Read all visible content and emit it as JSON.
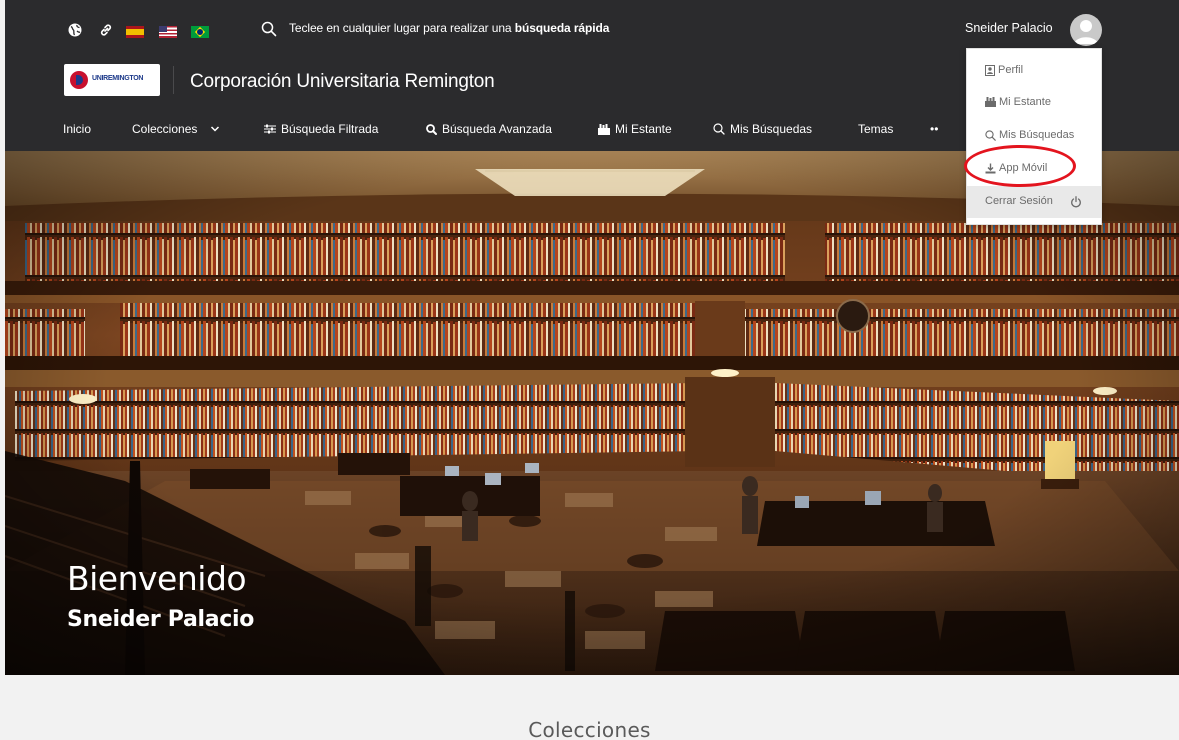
{
  "topbar": {
    "search_placeholder_prefix": "Teclee en cualquier lugar para realizar una ",
    "search_placeholder_bold": "búsqueda rápida",
    "user_name": "Sneider Palacio",
    "icons": [
      "globe-icon",
      "link-icon",
      "flag-spain-icon",
      "flag-usa-icon",
      "flag-brazil-icon",
      "search-icon"
    ]
  },
  "branding": {
    "logo_text": "UNIREMINGTON",
    "site_title": "Corporación Universitaria Remington"
  },
  "nav": {
    "items": [
      {
        "label": "Inicio"
      },
      {
        "label": "Colecciones",
        "icon": "chevron-down-icon"
      },
      {
        "label": "Búsqueda Filtrada",
        "icon": "filter-icon"
      },
      {
        "label": "Búsqueda Avanzada",
        "icon": "search-icon"
      },
      {
        "label": "Mi Estante",
        "icon": "shelf-icon"
      },
      {
        "label": "Mis Búsquedas",
        "icon": "search-icon"
      },
      {
        "label": "Temas"
      },
      {
        "label": "••"
      }
    ]
  },
  "user_menu": {
    "items": [
      {
        "label": "Perfil",
        "icon": "profile-icon"
      },
      {
        "label": "Mi Estante",
        "icon": "shelf-icon"
      },
      {
        "label": "Mis Búsquedas",
        "icon": "search-icon"
      },
      {
        "label": "App Móvil",
        "icon": "download-icon",
        "highlighted": true
      }
    ],
    "logout_label": "Cerrar Sesión",
    "logout_icon": "power-icon",
    "highlight_color": "#e3141e"
  },
  "hero": {
    "welcome": "Bienvenido",
    "user_name": "Sneider Palacio"
  },
  "main": {
    "collections_title": "Colecciones"
  },
  "colors": {
    "header_bg": "#2b2b2d",
    "page_bg": "#f2f2f2",
    "accent": "#e3141e"
  }
}
